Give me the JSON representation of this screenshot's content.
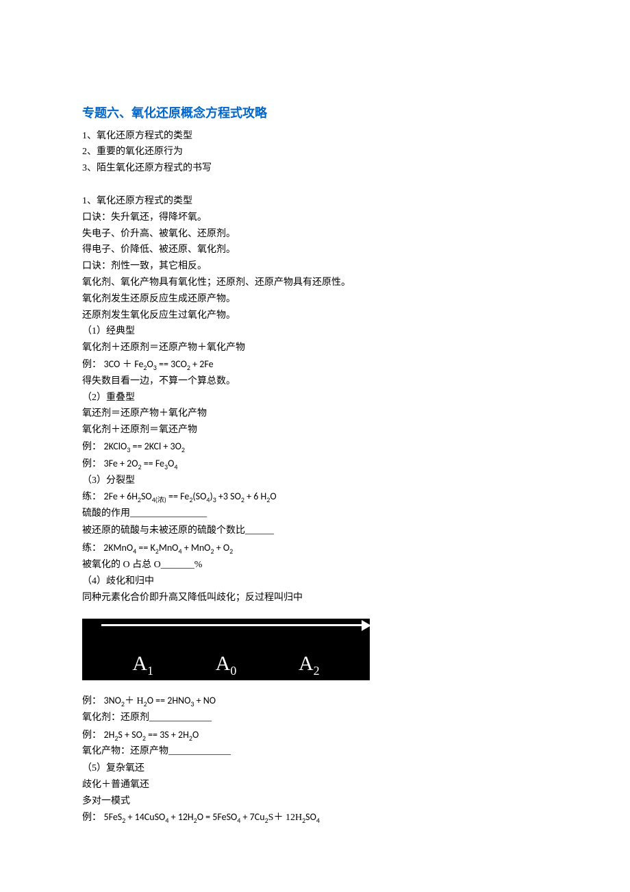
{
  "title": "专题六、氧化还原概念方程式攻略",
  "toc": {
    "l1": "1、氧化还原方程式的类型",
    "l2": "2、重要的氧化还原行为",
    "l3": "3、陌生氧化还原方程式的书写"
  },
  "section1_heading": "1、氧化还原方程式的类型",
  "mnemonics": {
    "m1": "口诀：失升氧还，得降坏氧。",
    "m2": "失电子、价升高、被氧化、还原剂。",
    "m3": "得电子、价降低、被还原、氧化剂。",
    "m4": "口诀：剂性一致，其它相反。",
    "m5": "氧化剂、氧化产物具有氧化性；还原剂、还原产物具有还原性。",
    "m6": "氧化剂发生还原反应生成还原产物。",
    "m7": "还原剂发生氧化反应生过氧化产物。"
  },
  "type1": {
    "hd": "（1）经典型",
    "desc": "氧化剂＋还原剂＝还原产物＋氧化产物",
    "ex_label": "例：",
    "tail_note": "得失数目看一边，不算一个算总数。"
  },
  "eq1": {
    "lhs1": "3CO",
    "plus": " ＋ ",
    "lhs2a": "Fe",
    "lhs2b": "2",
    "lhs2c": "O",
    "lhs2d": "3",
    "eq": " == ",
    "rhs1a": "3CO",
    "rhs1b": "2",
    "sep": "    +    ",
    "rhs2": "2Fe"
  },
  "type2": {
    "hd": "（2）重叠型",
    "desc1": "氧还剂＝还原产物＋氧化产物",
    "desc2": "氧化剂＋还原剂＝氧还产物",
    "ex_label": "例："
  },
  "eq2": {
    "a": "2KClO",
    "asub": "3",
    "eq": "    ==  ",
    "b": "2KCl    +    3O",
    "bsub": "2"
  },
  "eq3": {
    "a": "3Fe + 2O",
    "asub": "2",
    "eq": "       ==  ",
    "b": "Fe",
    "bsub": "3",
    "c": "O",
    "csub": "4"
  },
  "type3": {
    "hd": "（3）分裂型",
    "ex_label": "练：",
    "q1_a": "硫酸的作用",
    "q1_blank": "________________",
    "q2_a": "被还原的硫酸与未被还原的硫酸个数比",
    "q2_blank": "______",
    "q3_a": "被氧化的 O 占总 O",
    "q3_blank": "_______",
    "q3_pct": "%"
  },
  "eq4": {
    "a": "2Fe + 6H",
    "asub": "2",
    "b": "SO",
    "bsub": "4(浓)",
    "eq": "      ==  ",
    "c": "Fe",
    "csub": "2",
    "d": "(SO",
    "dsub": "4",
    "e": ")",
    "esub": "3",
    "f": " +3 SO",
    "fsub": "2",
    "g": "    + 6 H",
    "gsub": "2",
    "h": "O"
  },
  "eq5": {
    "pad": "        ",
    "a": "2KMnO",
    "asub": "4",
    "eq": "   ==      ",
    "b": "K",
    "bsub": "2",
    "c": "MnO",
    "csub": "4",
    "d": " +    MnO",
    "dsub": "2",
    "e": "    + O",
    "esub": "2"
  },
  "type4": {
    "hd": "（4）歧化和归中",
    "desc": "同种元素化合价即升高又降低叫歧化；反过程叫归中"
  },
  "diagram_labels": {
    "a1": "A",
    "a1s": "1",
    "a0": "A",
    "a0s": "0",
    "a2": "A",
    "a2s": "2"
  },
  "eq6_label": "例：    ",
  "eq6": {
    "a": "3NO",
    "asub": "2",
    "b": "＋  H",
    "bsub": "2",
    "c": "O == 2HNO",
    "csub": "3",
    "d": " + NO"
  },
  "q6": {
    "a": "氧化剂：还原剂",
    "blank": "_____________"
  },
  "eq7_label": "例：    ",
  "eq7": {
    "a": "2H",
    "asub": "2",
    "b": "S    + SO",
    "bsub": "2",
    "c": "    ==  3S    + 2H",
    "csub": "2",
    "d": "O"
  },
  "q7": {
    "a": "氧化产物：还原产物",
    "blank": "_____________"
  },
  "type5": {
    "hd": "（5）复杂氧还",
    "desc1": "歧化＋普通氧还",
    "desc2": "多对一模式",
    "ex_label": "例：    "
  },
  "eq8": {
    "a": "5FeS",
    "asub": "2",
    "b": " + 14CuSO",
    "bsub": "4",
    "c": " + 12H",
    "csub": "2",
    "d": "O =    5FeSO",
    "dsub": "4",
    "e": "    + 7Cu",
    "esub": "2",
    "f": "S＋  12H",
    "fsub": "2",
    "g": "SO",
    "gsub": "4"
  }
}
